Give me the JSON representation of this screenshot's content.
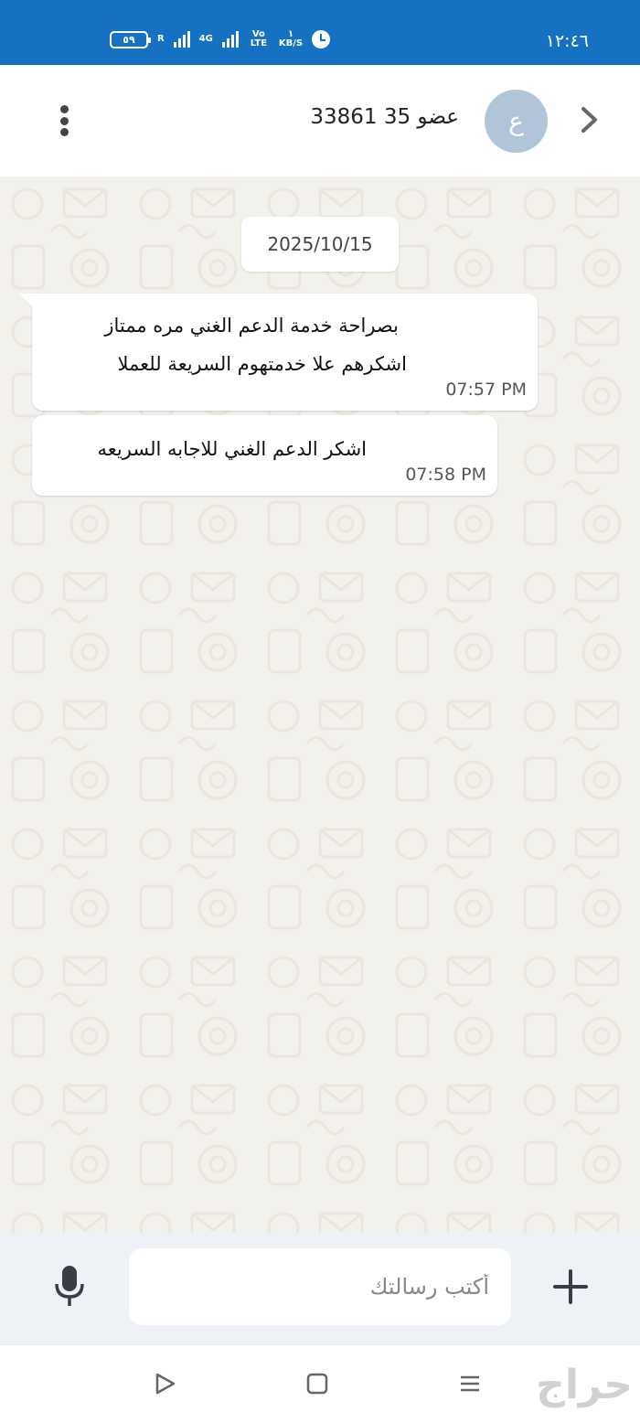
{
  "status_bar": {
    "time": "١٢:٤٦",
    "battery": "٥٩",
    "network": "4G",
    "volte": "Vo LTE",
    "speed_value": "١",
    "speed_unit": "KB/S",
    "roaming": "R"
  },
  "header": {
    "contact_name": "عضو 35 33861",
    "avatar_letter": "ع"
  },
  "chat": {
    "date": "2025/10/15",
    "messages": [
      {
        "line1": "بصراحة خدمة الدعم الغني مره ممتاز",
        "line2": "اشكرهم علا خدمتهوم السريعة للعملا",
        "time": "07:57 PM"
      },
      {
        "line1": "اشكر الدعم الغني للاجابه السريعه",
        "time": "07:58 PM"
      }
    ]
  },
  "input": {
    "placeholder": "أكتب رسالتك",
    "value": ""
  },
  "watermark": "حراج",
  "colors": {
    "status_bar": "#1572c2",
    "avatar": "#b1c4d8",
    "chat_bg": "#f3f1ec"
  }
}
